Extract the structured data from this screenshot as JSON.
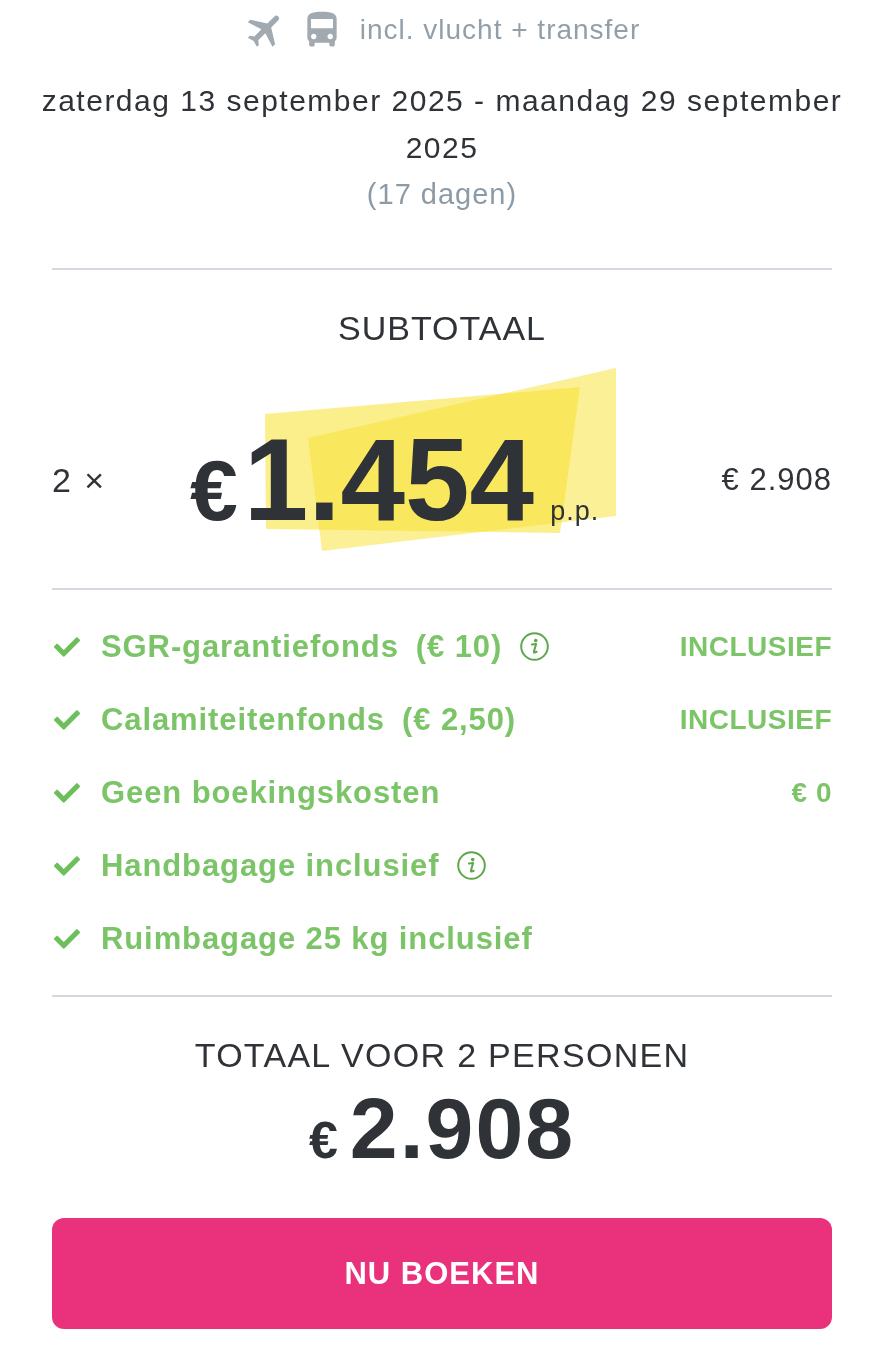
{
  "header": {
    "transport": "incl. vlucht + transfer"
  },
  "dates": {
    "range": "zaterdag 13 september 2025 - maandag 29 september 2025",
    "duration": "(17 dagen)"
  },
  "subtotal": {
    "title": "SUBTOTAAL",
    "quantity": "2 ×",
    "currency": "€",
    "price": "1.454",
    "unit": "p.p.",
    "line_total": "€ 2.908"
  },
  "inclusions": [
    {
      "label": "SGR-garantiefonds",
      "fee": "(€ 10)",
      "info": true,
      "value": "INCLUSIEF"
    },
    {
      "label": "Calamiteitenfonds",
      "fee": "(€ 2,50)",
      "info": false,
      "value": "INCLUSIEF"
    },
    {
      "label": "Geen boekingskosten",
      "info": false,
      "value": "€ 0"
    },
    {
      "label": "Handbagage inclusief",
      "info": true
    },
    {
      "label": "Ruimbagage 25 kg inclusief",
      "info": false
    }
  ],
  "total": {
    "title": "TOTAAL VOOR 2 PERSONEN",
    "currency": "€",
    "amount": "2.908"
  },
  "book_button": "NU BOEKEN"
}
